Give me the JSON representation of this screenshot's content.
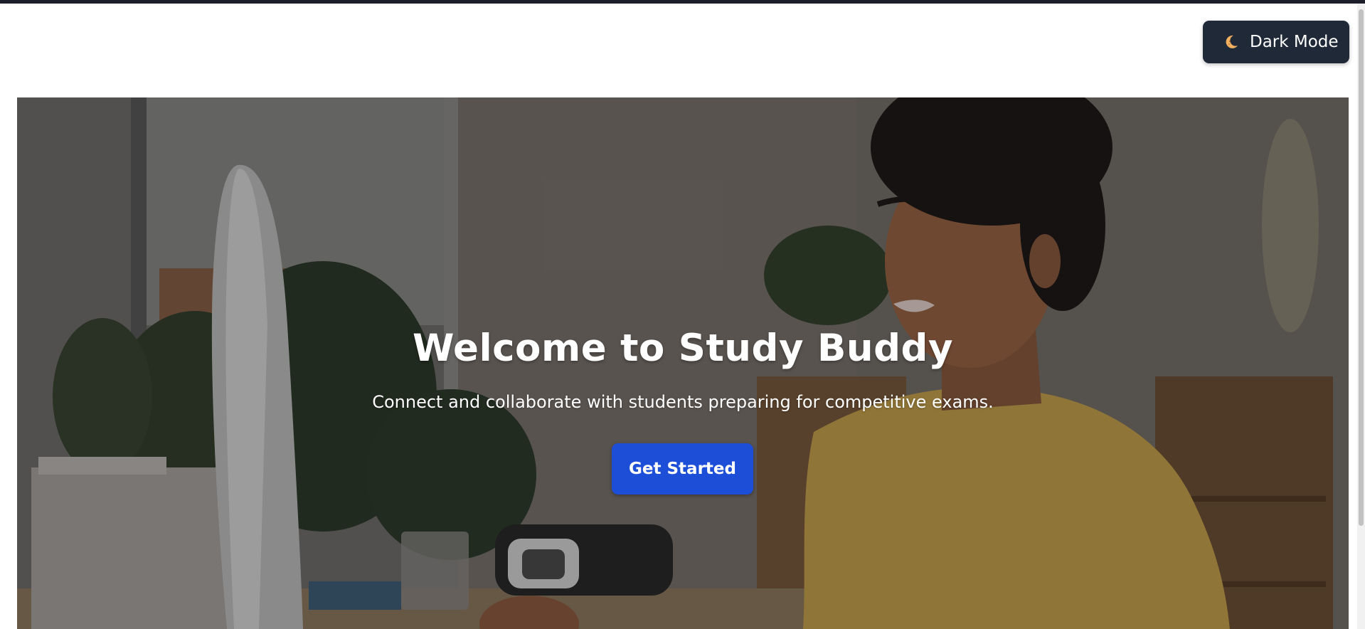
{
  "header": {
    "theme_toggle": {
      "icon": "moon-icon",
      "label": "Dark Mode"
    }
  },
  "hero": {
    "background_image": "hero-photo",
    "title": "Welcome to Study Buddy",
    "subtitle": "Connect and collaborate with students preparing for competitive exams.",
    "cta_label": "Get Started"
  },
  "colors": {
    "toggle_bg": "#1f2937",
    "cta_bg": "#1d4ed8",
    "moon": "#f0b060"
  }
}
